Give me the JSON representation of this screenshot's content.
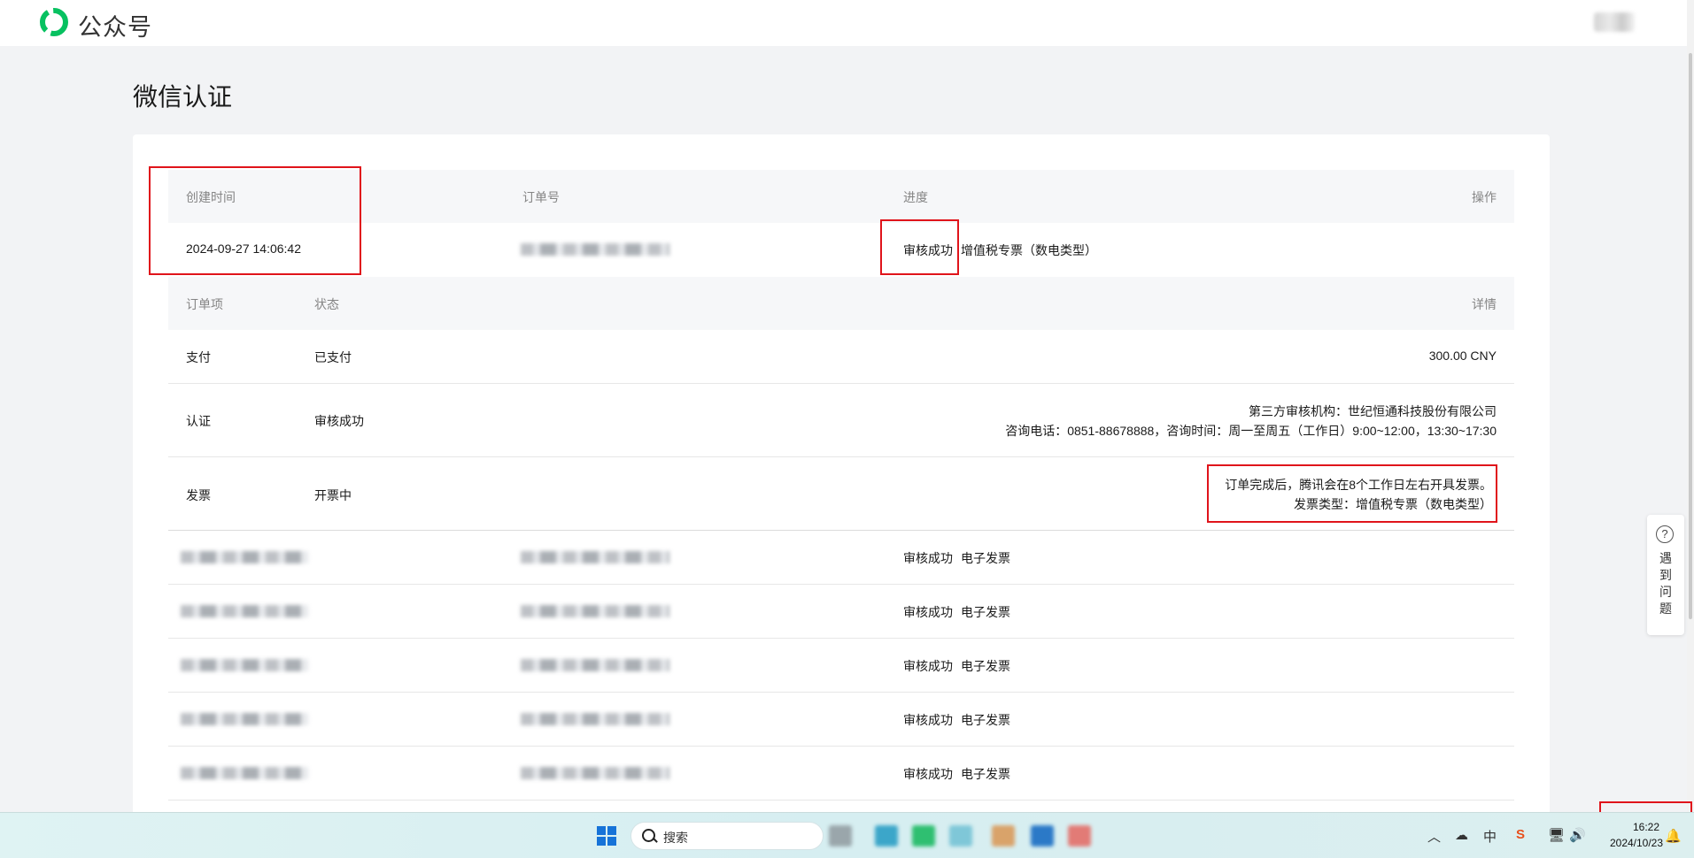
{
  "header": {
    "brand": "公众号"
  },
  "page": {
    "title": "微信认证"
  },
  "orders_table": {
    "headers": {
      "created": "创建时间",
      "order_no": "订单号",
      "progress": "进度",
      "action": "操作"
    },
    "first_order": {
      "created": "2024-09-27 14:06:42",
      "status": "审核成功",
      "invoice_type": "增值税专票（数电类型）"
    }
  },
  "detail_table": {
    "headers": {
      "item": "订单项",
      "status": "状态",
      "detail": "详情"
    },
    "rows": [
      {
        "item": "支付",
        "status": "已支付",
        "detail_lines": [
          "300.00 CNY"
        ]
      },
      {
        "item": "认证",
        "status": "审核成功",
        "detail_lines": [
          "第三方审核机构：世纪恒通科技股份有限公司",
          "咨询电话：0851-88678888，咨询时间：周一至周五（工作日）9:00~12:00，13:30~17:30"
        ]
      },
      {
        "item": "发票",
        "status": "开票中",
        "detail_lines": [
          "订单完成后，腾讯会在8个工作日左右开具发票。",
          "发票类型：增值税专票（数电类型）"
        ]
      }
    ]
  },
  "other_orders": [
    {
      "status": "审核成功",
      "invoice_type": "电子发票"
    },
    {
      "status": "审核成功",
      "invoice_type": "电子发票"
    },
    {
      "status": "审核成功",
      "invoice_type": "电子发票"
    },
    {
      "status": "审核成功",
      "invoice_type": "电子发票"
    },
    {
      "status": "审核成功",
      "invoice_type": "电子发票"
    }
  ],
  "help": {
    "icon": "question-icon",
    "label": "遇到问题"
  },
  "taskbar": {
    "search_placeholder": "搜索",
    "tray": {
      "ime": "中",
      "time": "16:22",
      "date": "2024/10/23"
    }
  },
  "colors": {
    "highlight": "#e0141b",
    "brand_green": "#07c160",
    "windows_blue": "#1673d8"
  }
}
